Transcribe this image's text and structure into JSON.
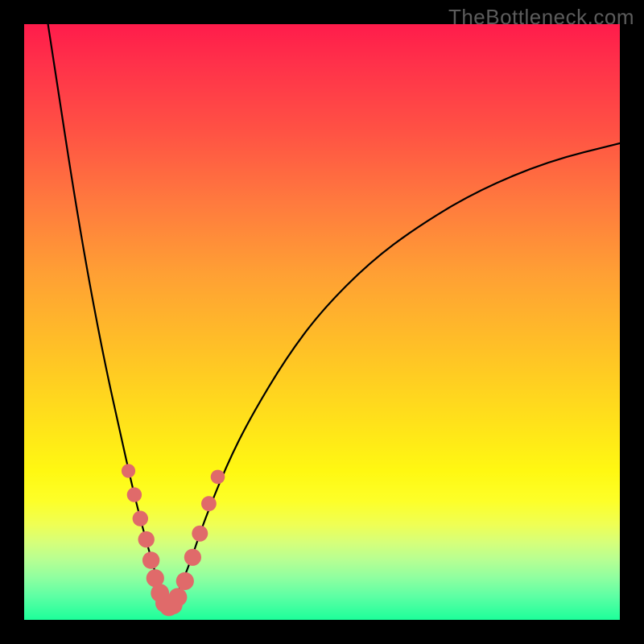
{
  "watermark": "TheBottleneck.com",
  "colors": {
    "frame": "#000000",
    "curve": "#000000",
    "dot": "#e06a6a",
    "gradient_top": "#ff1c4b",
    "gradient_bottom": "#1dff9a"
  },
  "chart_data": {
    "type": "line",
    "title": "",
    "xlabel": "",
    "ylabel": "",
    "xlim": [
      0,
      100
    ],
    "ylim": [
      0,
      100
    ],
    "note": "V-shaped curve; y is roughly a bottleneck-percentage metric (low = good / green) vs an unlabeled x parameter. Minimum of the curve sits near x≈24. Axes have no tick labels in the source image; numeric values are estimated from pixel positions.",
    "series": [
      {
        "name": "curve",
        "x": [
          4,
          6,
          8,
          10,
          12,
          14,
          16,
          18,
          20,
          22,
          23,
          24,
          25,
          26,
          28,
          30,
          34,
          38,
          44,
          50,
          58,
          66,
          76,
          88,
          100
        ],
        "y": [
          100,
          87,
          74,
          62,
          51,
          41,
          32,
          23,
          15,
          8,
          4,
          2,
          3,
          5,
          10,
          16,
          26,
          34,
          44,
          52,
          60,
          66,
          72,
          77,
          80
        ]
      }
    ],
    "dots": {
      "name": "highlighted-points",
      "note": "Salmon-colored sample dots clustered around the curve's lowest region.",
      "x": [
        17.5,
        18.5,
        19.5,
        20.5,
        21.3,
        22.0,
        22.8,
        23.6,
        24.3,
        25.0,
        25.8,
        27.0,
        28.3,
        29.5,
        31.0,
        32.5
      ],
      "y": [
        25.0,
        21.0,
        17.0,
        13.5,
        10.0,
        7.0,
        4.5,
        2.8,
        2.2,
        2.5,
        3.8,
        6.5,
        10.5,
        14.5,
        19.5,
        24.0
      ]
    }
  }
}
